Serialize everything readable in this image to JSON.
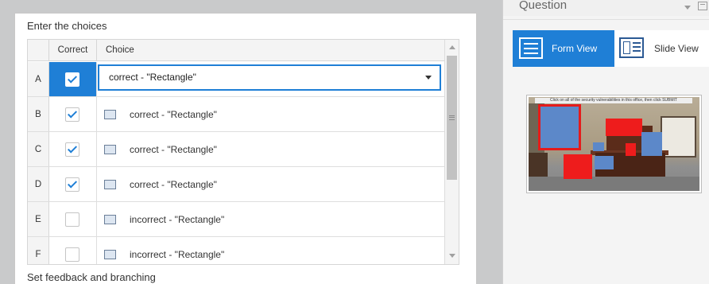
{
  "editor": {
    "section_choices": "Enter the choices",
    "section_feedback": "Set feedback and branching",
    "grid": {
      "col_correct": "Correct",
      "col_choice": "Choice",
      "rows": [
        {
          "letter": "A",
          "correct": true,
          "choice": "correct - \"Rectangle\"",
          "selected": true
        },
        {
          "letter": "B",
          "correct": true,
          "choice": "correct - \"Rectangle\""
        },
        {
          "letter": "C",
          "correct": true,
          "choice": "correct - \"Rectangle\""
        },
        {
          "letter": "D",
          "correct": true,
          "choice": "correct - \"Rectangle\""
        },
        {
          "letter": "E",
          "correct": false,
          "choice": "incorrect - \"Rectangle\""
        },
        {
          "letter": "F",
          "correct": false,
          "choice": "incorrect - \"Rectangle\""
        }
      ]
    }
  },
  "question_panel": {
    "title": "Question",
    "form_view_label": "Form View",
    "slide_view_label": "Slide View",
    "active_view": "Form View",
    "thumbnail_caption": "Click on all of the security vulnerabilities in this office, then click SUBMIT"
  },
  "colors": {
    "accent": "#1f7fd6",
    "hotspot_correct": "#ee1c1c",
    "hotspot_blue": "#5c88c9"
  },
  "icons": {
    "row_choice_icon": "rectangle-shape-icon",
    "dropdown_icon": "chevron-down-icon",
    "form_view_icon": "form-view-icon",
    "slide_view_icon": "slide-view-icon"
  }
}
